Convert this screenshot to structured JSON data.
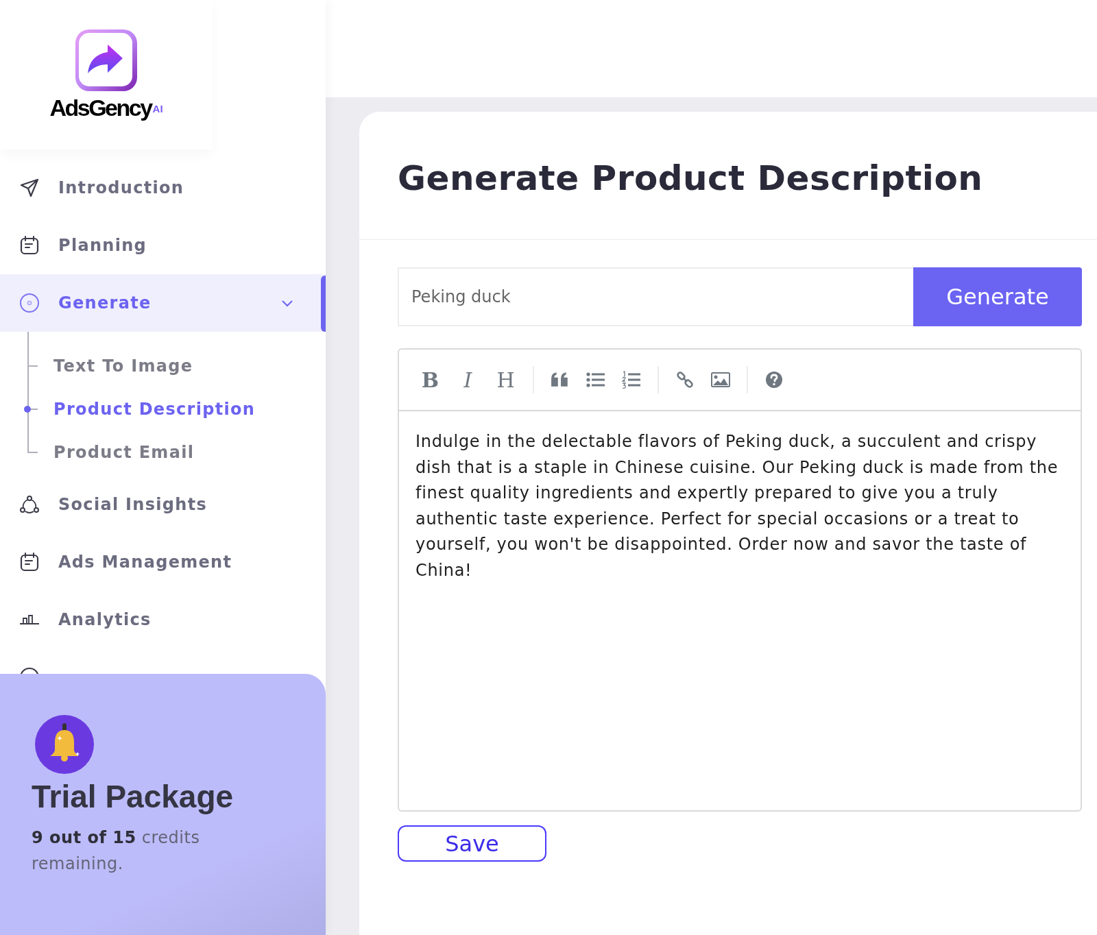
{
  "logo": {
    "name": "AdsGency",
    "suffix": "AI"
  },
  "sidebar": {
    "items": [
      {
        "label": "Introduction",
        "selected": false
      },
      {
        "label": "Planning",
        "selected": false
      },
      {
        "label": "Generate",
        "selected": true,
        "expanded": true,
        "children": [
          {
            "label": "Text To Image",
            "selected": false
          },
          {
            "label": "Product Description",
            "selected": true
          },
          {
            "label": "Product Email",
            "selected": false
          }
        ]
      },
      {
        "label": "Social Insights",
        "selected": false
      },
      {
        "label": "Ads Management",
        "selected": false
      },
      {
        "label": "Analytics",
        "selected": false
      },
      {
        "selected": false
      }
    ]
  },
  "plan_card": {
    "title": "Trial Package",
    "text": "**9 out of 15** credits remaining."
  },
  "page": {
    "title": "Generate Product Description"
  },
  "prompt": {
    "value": "Peking duck",
    "button": "Generate"
  },
  "toolbar": [
    {
      "kind": "glyph",
      "label": "B"
    },
    {
      "kind": "glyph",
      "label": "I"
    },
    {
      "kind": "glyph",
      "label": "H"
    },
    {
      "kind": "separator"
    },
    {
      "kind": "quote"
    },
    {
      "kind": "bullet-list"
    },
    {
      "kind": "numbered-list"
    },
    {
      "kind": "separator"
    },
    {
      "kind": "link"
    },
    {
      "kind": "image"
    },
    {
      "kind": "separator"
    },
    {
      "kind": "help"
    }
  ],
  "editor": {
    "text": "Indulge in the delectable flavors of Peking duck, a succulent and crispy dish that is a staple in Chinese cuisine. Our Peking duck is made from the finest quality ingredients and expertly prepared to give you a truly authentic taste experience. Perfect for special occasions or a treat to yourself, you won't be disappointed. Order now and savor the taste of China!"
  },
  "save_button": "Save"
}
